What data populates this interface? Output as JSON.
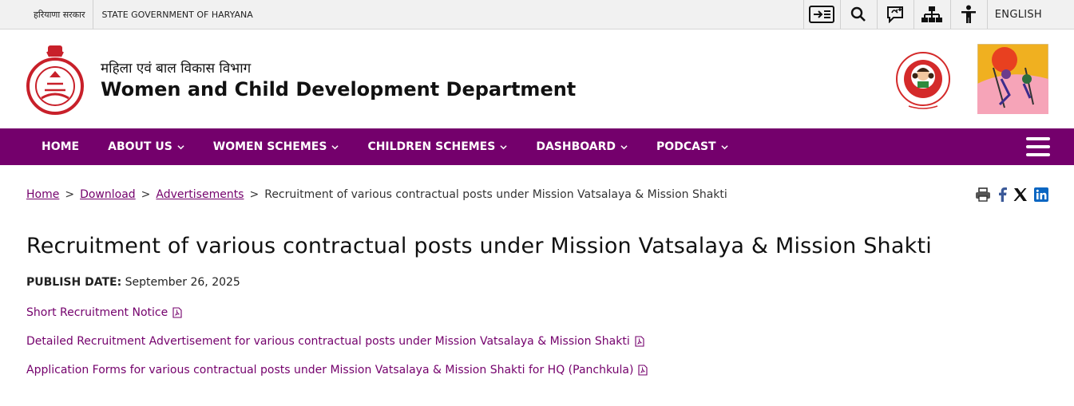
{
  "topbar": {
    "hindi_govt": "हरियाणा सरकार",
    "state_govt": "STATE GOVERNMENT OF HARYANA",
    "icons": [
      "skip-to-content-icon",
      "search-icon",
      "sign-language-icon",
      "sitemap-icon",
      "accessibility-icon"
    ],
    "language": "ENGLISH"
  },
  "header": {
    "hindi_title": "महिला एवं बाल विकास विभाग",
    "title": "Women and Child Development Department"
  },
  "nav": {
    "items": [
      {
        "label": "HOME",
        "dropdown": false
      },
      {
        "label": "ABOUT US",
        "dropdown": true
      },
      {
        "label": "WOMEN SCHEMES",
        "dropdown": true
      },
      {
        "label": "CHILDREN SCHEMES",
        "dropdown": true
      },
      {
        "label": "DASHBOARD",
        "dropdown": true
      },
      {
        "label": "PODCAST",
        "dropdown": true
      }
    ]
  },
  "breadcrumb": {
    "home": "Home",
    "sep": ">",
    "download": "Download",
    "advertisements": "Advertisements",
    "current": "Recruitment of various contractual posts under Mission Vatsalaya & Mission Shakti"
  },
  "share": [
    "print-icon",
    "facebook-icon",
    "x-icon",
    "linkedin-icon"
  ],
  "main": {
    "title": "Recruitment of various contractual posts under Mission Vatsalaya & Mission Shakti",
    "publish_label": "PUBLISH DATE:",
    "publish_date": "September 26, 2025",
    "docs": [
      "Short Recruitment Notice",
      "Detailed Recruitment Advertisement for various contractual posts under Mission Vatsalaya & Mission Shakti",
      "Application Forms for various contractual posts under Mission Vatsalaya & Mission Shakti for HQ (Panchkula)"
    ]
  },
  "colors": {
    "brand": "#74006c",
    "topbar_bg": "#f1f1f1"
  }
}
